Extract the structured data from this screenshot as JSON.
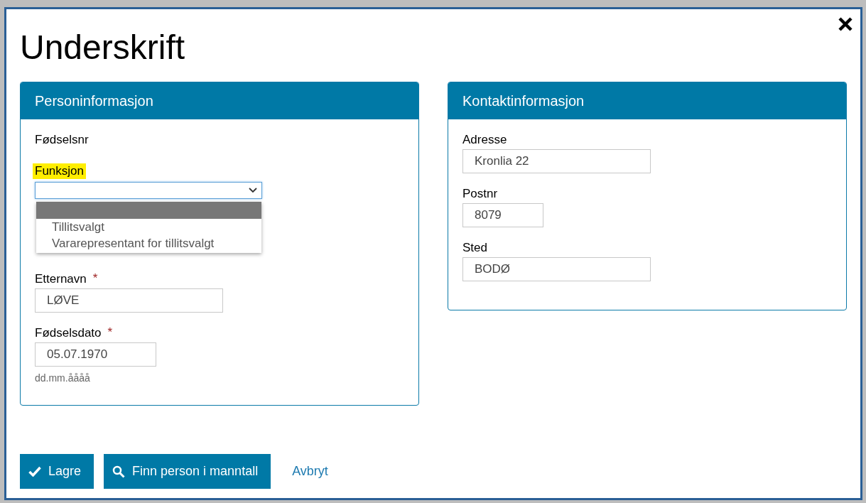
{
  "dialog": {
    "title": "Underskrift"
  },
  "person_panel": {
    "title": "Personinformasjon",
    "fields": [
      {
        "kind": "text",
        "label": "Fødselsnr"
      },
      {
        "kind": "select",
        "label": "Funksjon",
        "highlighted": true,
        "expanded": true,
        "options": [
          {
            "selected": true
          },
          {
            "label": "Tillitsvalgt",
            "selected": false
          },
          {
            "label": "Vararepresentant for tillitsvalgt",
            "selected": false
          }
        ]
      },
      {
        "kind": "input",
        "label": "Etternavn",
        "required_mark": "*",
        "value": "LØVE"
      },
      {
        "kind": "input",
        "label": "Fødselsdato",
        "required_mark": "*",
        "value": "05.07.1970",
        "hint": "dd.mm.åååå"
      }
    ]
  },
  "contact_panel": {
    "title": "Kontaktinformasjon",
    "fields": [
      {
        "kind": "input",
        "label": "Adresse",
        "value": "Kronlia 22"
      },
      {
        "kind": "input",
        "label": "Postnr",
        "value": "8079"
      },
      {
        "kind": "input",
        "label": "Sted",
        "value": "BODØ"
      }
    ]
  },
  "buttons": [
    {
      "kind": "primary",
      "label": "Lagre"
    },
    {
      "kind": "primary",
      "label": "Finn person i manntall"
    },
    {
      "kind": "link",
      "label": "Avbryt"
    }
  ]
}
